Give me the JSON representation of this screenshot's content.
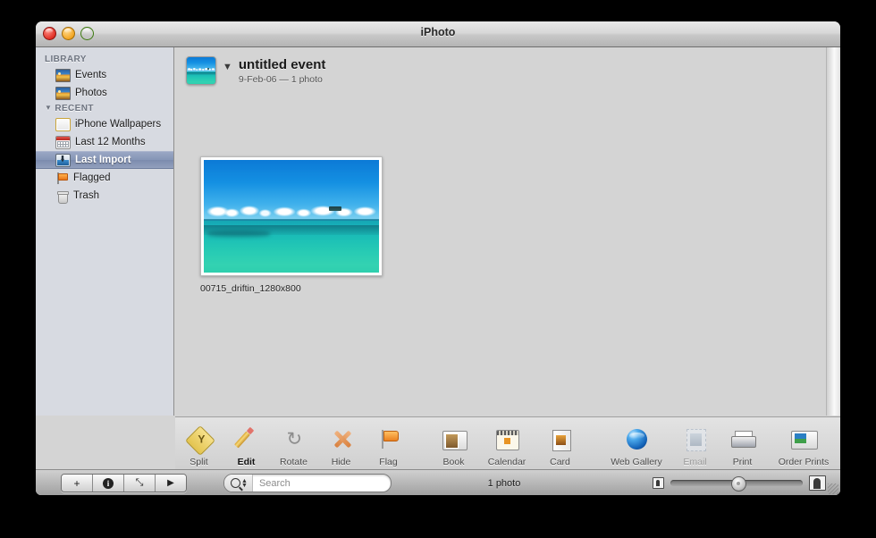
{
  "window": {
    "title": "iPhoto",
    "traffic_lights": [
      "close-button",
      "minimize-button",
      "zoom-button"
    ]
  },
  "sidebar": {
    "groups": [
      {
        "label": "LIBRARY",
        "items": [
          {
            "label": "Events",
            "icon": "photo-icon",
            "selected": false
          },
          {
            "label": "Photos",
            "icon": "photo-icon",
            "selected": false
          }
        ]
      },
      {
        "label": "RECENT",
        "items": [
          {
            "label": "iPhone Wallpapers",
            "icon": "album-icon",
            "selected": false
          },
          {
            "label": "Last 12 Months",
            "icon": "calendar-icon",
            "selected": false
          },
          {
            "label": "Last Import",
            "icon": "import-icon",
            "selected": true
          },
          {
            "label": "Flagged",
            "icon": "flag-icon",
            "selected": false
          },
          {
            "label": "Trash",
            "icon": "trash-icon",
            "selected": false
          }
        ]
      }
    ]
  },
  "event": {
    "title": "untitled event",
    "subtitle": "9-Feb-06 — 1 photo",
    "disclosure": "▼"
  },
  "photos": [
    {
      "filename": "00715_driftin_1280x800"
    }
  ],
  "toolbar": {
    "groups": [
      {
        "items": [
          {
            "label": "Split",
            "icon": "split-icon",
            "state": "normal"
          },
          {
            "label": "Edit",
            "icon": "pencil-icon",
            "state": "active"
          },
          {
            "label": "Rotate",
            "icon": "rotate-icon",
            "state": "normal"
          },
          {
            "label": "Hide",
            "icon": "hide-x-icon",
            "state": "normal"
          },
          {
            "label": "Flag",
            "icon": "flag-icon",
            "state": "normal"
          }
        ]
      },
      {
        "items": [
          {
            "label": "Book",
            "icon": "book-icon",
            "state": "normal"
          },
          {
            "label": "Calendar",
            "icon": "calendar-icon",
            "state": "normal"
          },
          {
            "label": "Card",
            "icon": "card-icon",
            "state": "normal"
          }
        ]
      },
      {
        "items": [
          {
            "label": "Web Gallery",
            "icon": "globe-icon",
            "state": "normal"
          },
          {
            "label": "Email",
            "icon": "email-stamp-icon",
            "state": "disabled"
          },
          {
            "label": "Print",
            "icon": "printer-icon",
            "state": "normal"
          },
          {
            "label": "Order Prints",
            "icon": "order-prints-icon",
            "state": "normal"
          }
        ]
      }
    ]
  },
  "statusbar": {
    "buttons": [
      {
        "label": "+",
        "icon": "plus-icon"
      },
      {
        "label": "i",
        "icon": "info-icon"
      },
      {
        "label": "⤡",
        "icon": "fullscreen-icon"
      },
      {
        "label": "▶",
        "icon": "play-icon"
      }
    ],
    "search": {
      "placeholder": "Search",
      "value": ""
    },
    "status_text": "1 photo",
    "zoom": {
      "min_icon": "small-thumbnail-icon",
      "max_icon": "large-thumbnail-icon",
      "value": 46
    }
  }
}
